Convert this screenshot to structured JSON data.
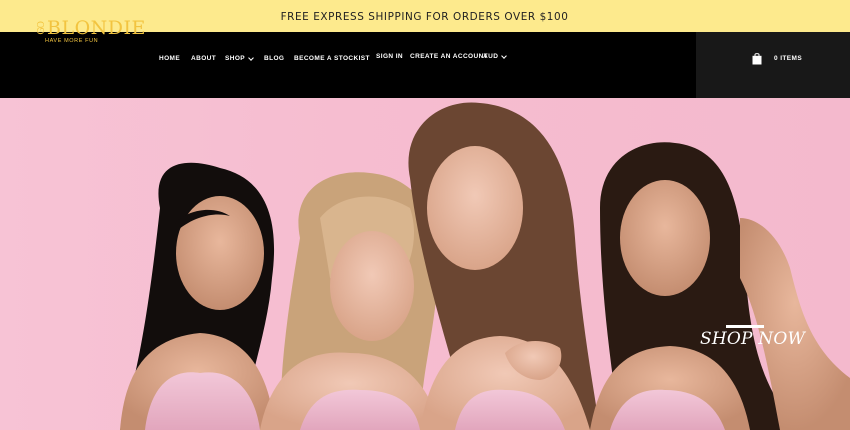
{
  "announcement": {
    "text": "FREE EXPRESS SHIPPING FOR ORDERS OVER $100"
  },
  "brand": {
    "logo_word": "BLONDIE",
    "logo_mark": "GO",
    "tagline": "HAVE MORE FUN",
    "color": "#f2c440"
  },
  "nav": {
    "home": "HOME",
    "about": "ABOUT",
    "shop": "SHOP",
    "blog": "BLOG",
    "stockist": "BECOME A STOCKIST"
  },
  "utility": {
    "sign_in": "SIGN IN",
    "create_account": "CREATE AN ACCOUNT",
    "currency": "AUD"
  },
  "cart": {
    "count_label": "0 ITEMS",
    "icon": "shopping-bag-icon"
  },
  "hero": {
    "cta": "SHOP NOW",
    "background": "#f6bfd2"
  },
  "colors": {
    "announcement_bg": "#fdea8d",
    "header_bg": "#000000",
    "cart_bg": "#181818"
  }
}
